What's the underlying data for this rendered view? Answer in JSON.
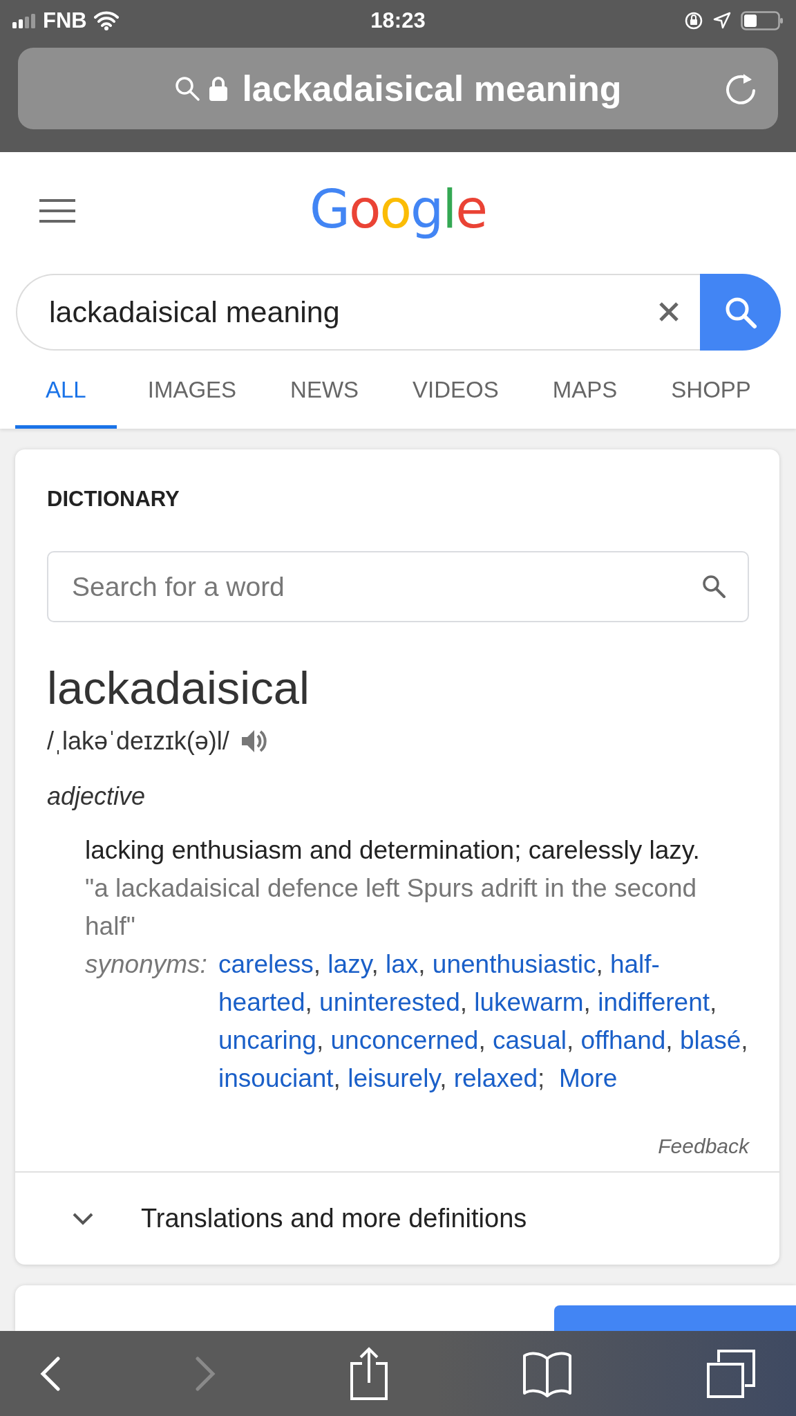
{
  "status_bar": {
    "carrier": "FNB",
    "time": "18:23"
  },
  "address_bar": {
    "text": "lackadaisical meaning"
  },
  "logo": "Google",
  "search": {
    "value": "lackadaisical meaning"
  },
  "tabs": [
    {
      "label": "ALL",
      "selected": true
    },
    {
      "label": "IMAGES",
      "selected": false
    },
    {
      "label": "NEWS",
      "selected": false
    },
    {
      "label": "VIDEOS",
      "selected": false
    },
    {
      "label": "MAPS",
      "selected": false
    },
    {
      "label": "SHOPP",
      "selected": false
    }
  ],
  "dictionary": {
    "heading": "DICTIONARY",
    "search_placeholder": "Search for a word",
    "word": "lackadaisical",
    "pronunciation": "/ˌlakəˈdeɪzɪk(ə)l/",
    "part_of_speech": "adjective",
    "definition": "lacking enthusiasm and determination; carelessly lazy.",
    "example": "\"a lackadaisical defence left Spurs adrift in the second half\"",
    "synonyms_label": "synonyms:",
    "synonyms": [
      "careless",
      "lazy",
      "lax",
      "unenthusiastic",
      "half-hearted",
      "uninterested",
      "lukewarm",
      "indifferent",
      "uncaring",
      "unconcerned",
      "casual",
      "offhand",
      "blasé",
      "insouciant",
      "leisurely",
      "relaxed"
    ],
    "separator": ",",
    "final_separator": ";",
    "more": "More",
    "feedback": "Feedback",
    "expander": "Translations and more definitions"
  }
}
